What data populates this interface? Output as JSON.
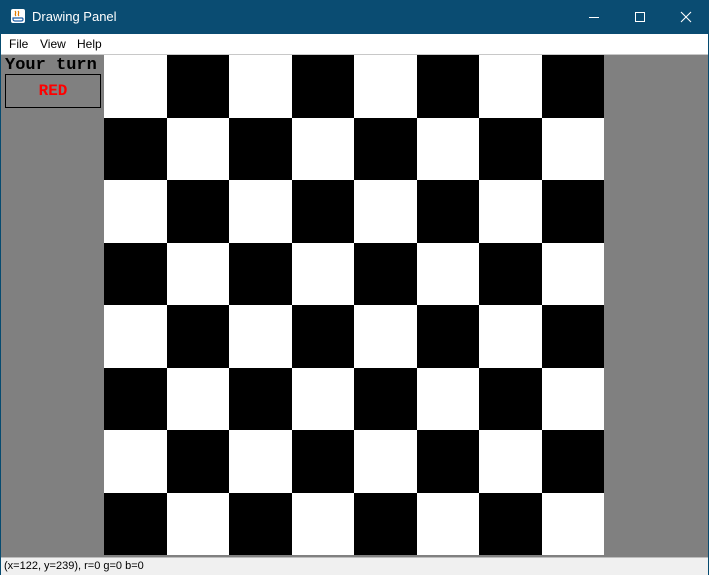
{
  "window": {
    "title": "Drawing Panel",
    "controls": {
      "minimize_icon": "minimize-icon",
      "maximize_icon": "maximize-icon",
      "close_icon": "close-icon"
    }
  },
  "menubar": {
    "items": [
      {
        "label": "File"
      },
      {
        "label": "View"
      },
      {
        "label": "Help"
      }
    ]
  },
  "game": {
    "turn_label": "Your turn",
    "turn_value": "RED",
    "turn_color": "#ff0000",
    "board": {
      "rows": 8,
      "cols": 8,
      "first_square": "white",
      "light_color": "#ffffff",
      "dark_color": "#000000"
    },
    "background_color": "#808080"
  },
  "statusbar": {
    "text": "(x=122, y=239), r=0 g=0 b=0"
  }
}
